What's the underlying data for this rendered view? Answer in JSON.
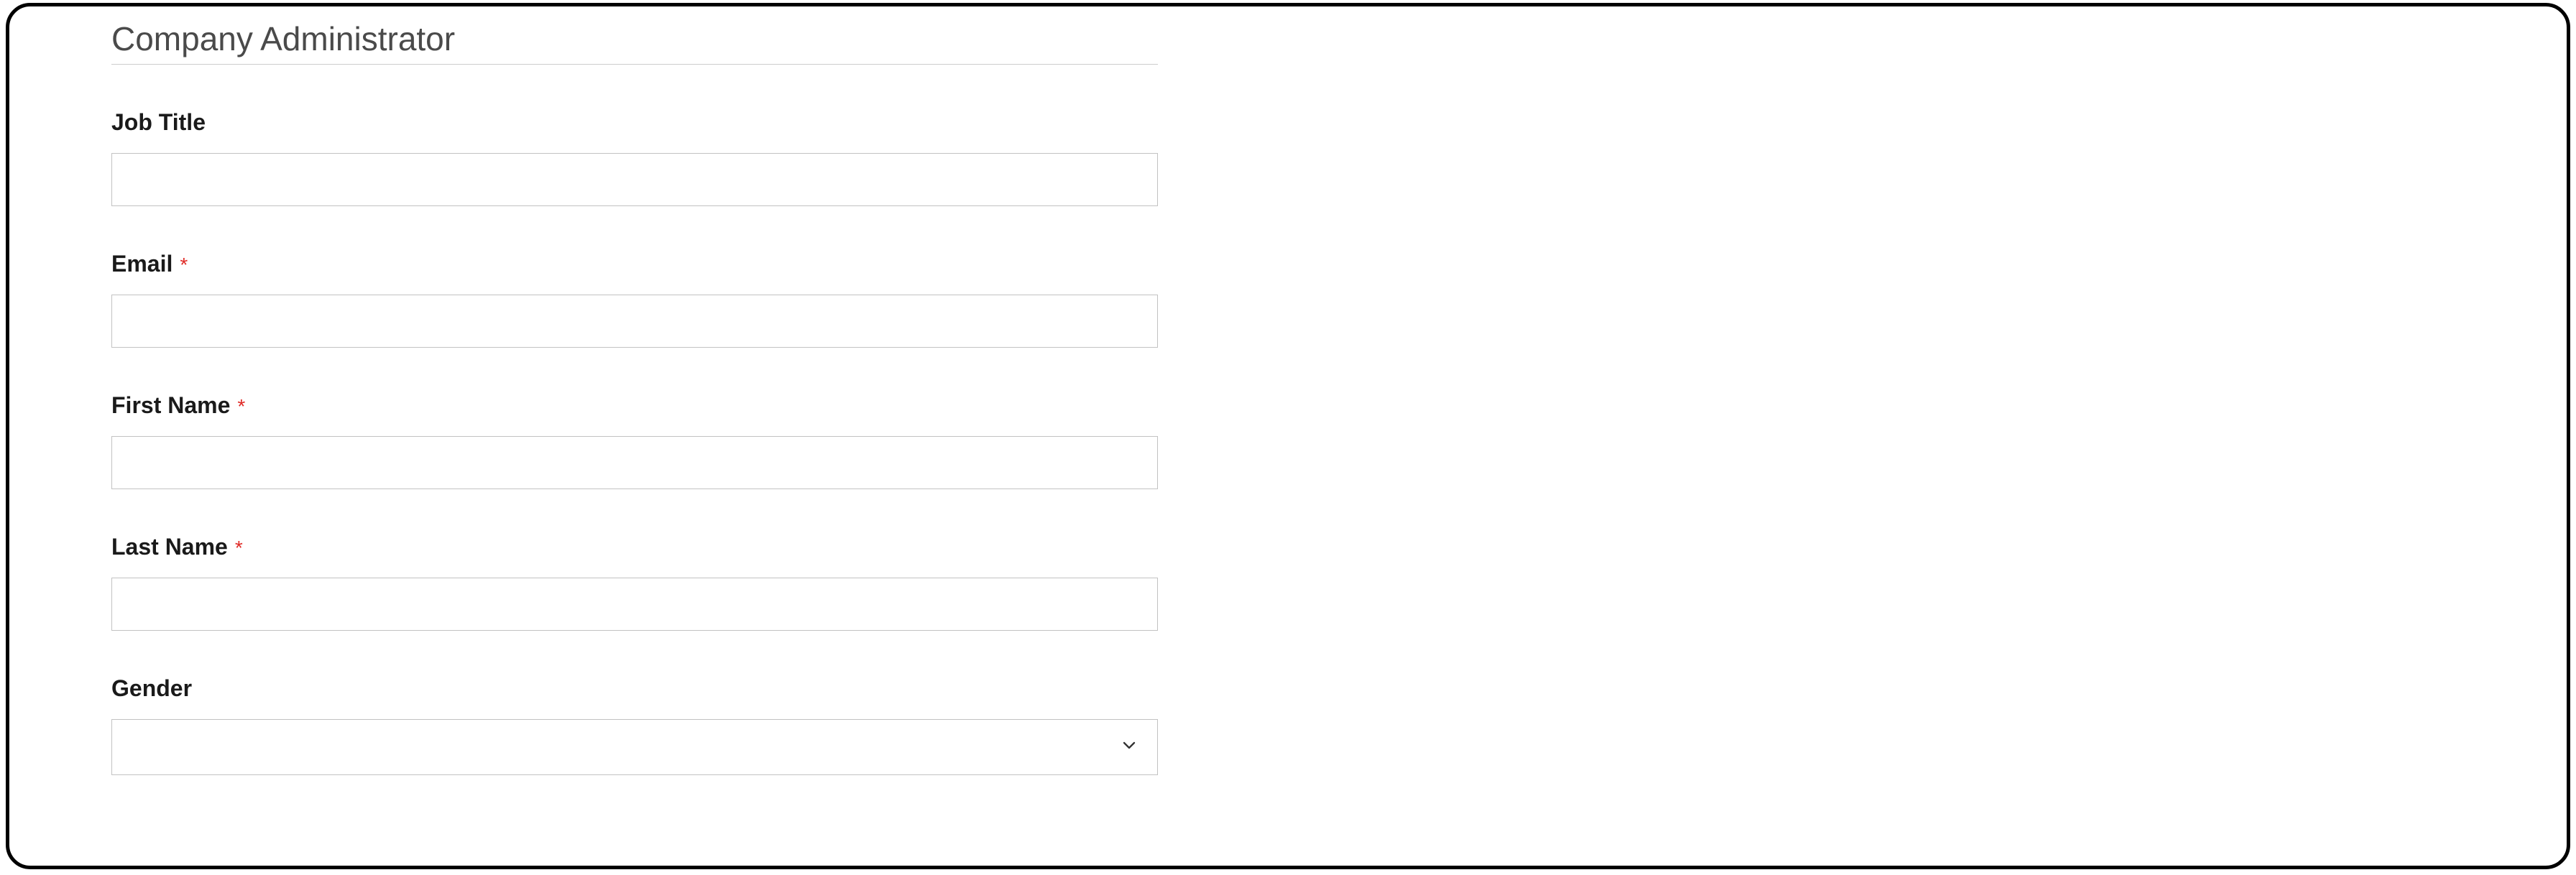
{
  "section": {
    "title": "Company Administrator"
  },
  "labels": {
    "job_title": "Job Title",
    "email": "Email",
    "first_name": "First Name",
    "last_name": "Last Name",
    "gender": "Gender",
    "required_mark": "*"
  },
  "values": {
    "job_title": "",
    "email": "",
    "first_name": "",
    "last_name": "",
    "gender": ""
  }
}
